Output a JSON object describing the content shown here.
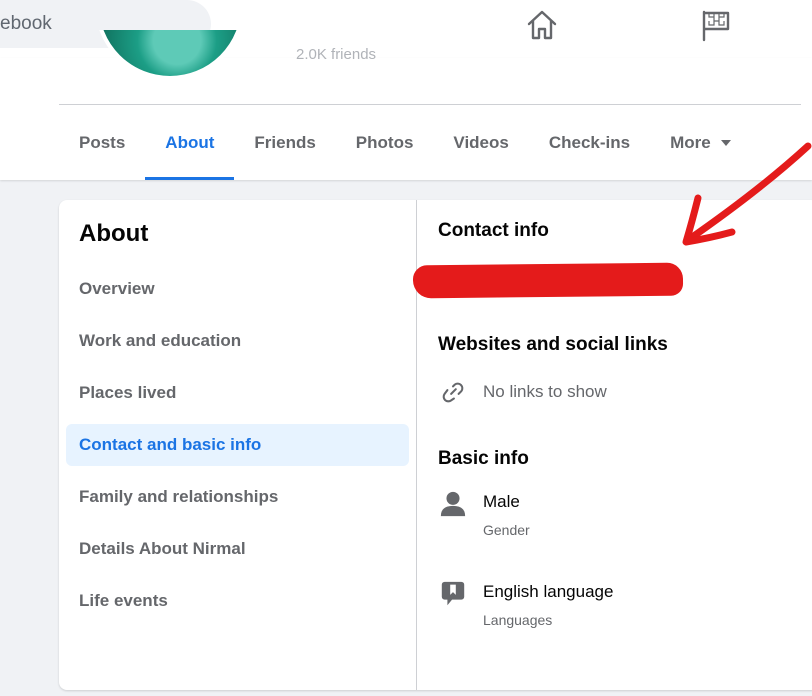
{
  "header": {
    "search_text": "ebook",
    "icons": [
      "home-icon",
      "flag-icon"
    ]
  },
  "profile": {
    "friends_peek": "2.0K friends"
  },
  "tabs": [
    {
      "label": "Posts"
    },
    {
      "label": "About",
      "active": true
    },
    {
      "label": "Friends"
    },
    {
      "label": "Photos"
    },
    {
      "label": "Videos"
    },
    {
      "label": "Check-ins"
    },
    {
      "label": "More"
    }
  ],
  "about": {
    "title": "About",
    "nav": [
      {
        "label": "Overview"
      },
      {
        "label": "Work and education"
      },
      {
        "label": "Places lived"
      },
      {
        "label": "Contact and basic info",
        "active": true
      },
      {
        "label": "Family and relationships"
      },
      {
        "label": "Details About Nirmal"
      },
      {
        "label": "Life events"
      }
    ]
  },
  "contact": {
    "title": "Contact info",
    "icon": "id-card-icon"
  },
  "websites": {
    "title": "Websites and social links",
    "icon": "link-icon",
    "empty_text": "No links to show"
  },
  "basic": {
    "title": "Basic info",
    "gender": {
      "icon": "person-icon",
      "value": "Male",
      "label": "Gender"
    },
    "languages": {
      "icon": "speech-bubble-icon",
      "value": "English language",
      "label": "Languages"
    }
  },
  "annotations": {
    "redaction_color": "#e41b1b",
    "arrow_color": "#e41b1b"
  },
  "colors": {
    "accent": "#1b74e4",
    "active_bg": "#e7f3ff",
    "text_secondary": "#65676b"
  }
}
